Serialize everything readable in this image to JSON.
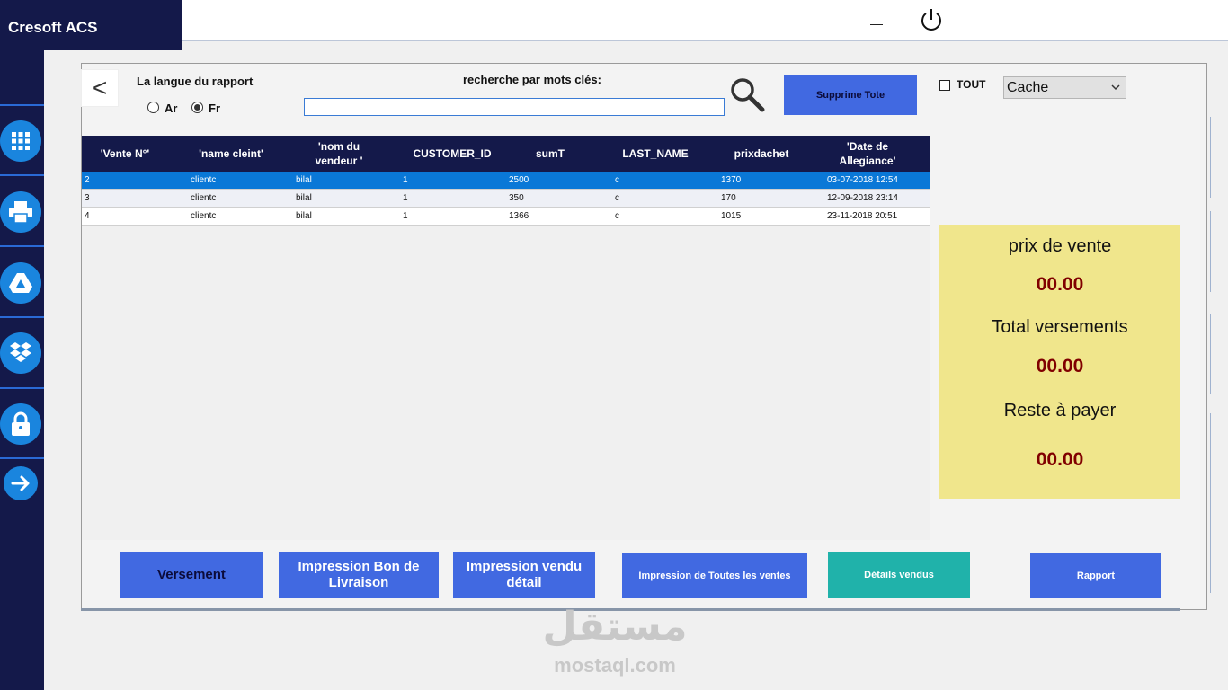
{
  "app": {
    "title": "Cresoft ACS"
  },
  "colors": {
    "sidebar": "#14194a",
    "accent": "#4169e1",
    "teal": "#20b2aa",
    "summary_bg": "#f0e68c",
    "summary_value": "#800000",
    "selected_row": "#0a78d7"
  },
  "icons": [
    "apps-grid-icon",
    "printer-icon",
    "google-drive-icon",
    "dropbox-icon",
    "lock-icon",
    "arrow-right-icon",
    "power-icon",
    "search-icon",
    "back-chevron-icon"
  ],
  "header": {
    "back_label": "<",
    "language_label": "La langue du rapport",
    "lang_options": [
      {
        "label": "Ar",
        "checked": false
      },
      {
        "label": "Fr",
        "checked": true
      }
    ],
    "search_label": "recherche par mots clés:",
    "search_value": "",
    "delete_all_label": "Supprime Tote",
    "all_checkbox_label": "TOUT",
    "all_checked": false,
    "filter_select_value": "Cache"
  },
  "table": {
    "columns": [
      "'Vente N°'",
      "'name cleint'",
      "'nom du vendeur '",
      "CUSTOMER_ID",
      "sumT",
      "LAST_NAME",
      "prixdachet",
      "'Date de Allegiance'"
    ],
    "rows": [
      [
        "2",
        "clientc",
        "bilal",
        "1",
        "2500",
        "c",
        "1370",
        "03-07-2018 12:54"
      ],
      [
        "3",
        "clientc",
        "bilal",
        "1",
        "350",
        "c",
        "170",
        "12-09-2018 23:14"
      ],
      [
        "4",
        "clientc",
        "bilal",
        "1",
        "1366",
        "c",
        "1015",
        "23-11-2018 20:51"
      ]
    ],
    "selected_row": 0
  },
  "summary": {
    "prix_vente_label": "prix de vente",
    "prix_vente_value": "00.00",
    "total_versements_label": "Total versements",
    "total_versements_value": "00.00",
    "reste_label": "Reste à payer",
    "reste_value": "00.00"
  },
  "actions": {
    "versement": "Versement",
    "bon_livraison": "Impression Bon de Livraison",
    "vendu_detail": "Impression vendu détail",
    "toutes_ventes": "Impression de Toutes les ventes",
    "details_vendus": "Détails vendus",
    "rapport": "Rapport"
  },
  "watermark": {
    "arabic": "مستقل",
    "latin": "mostaql.com"
  }
}
